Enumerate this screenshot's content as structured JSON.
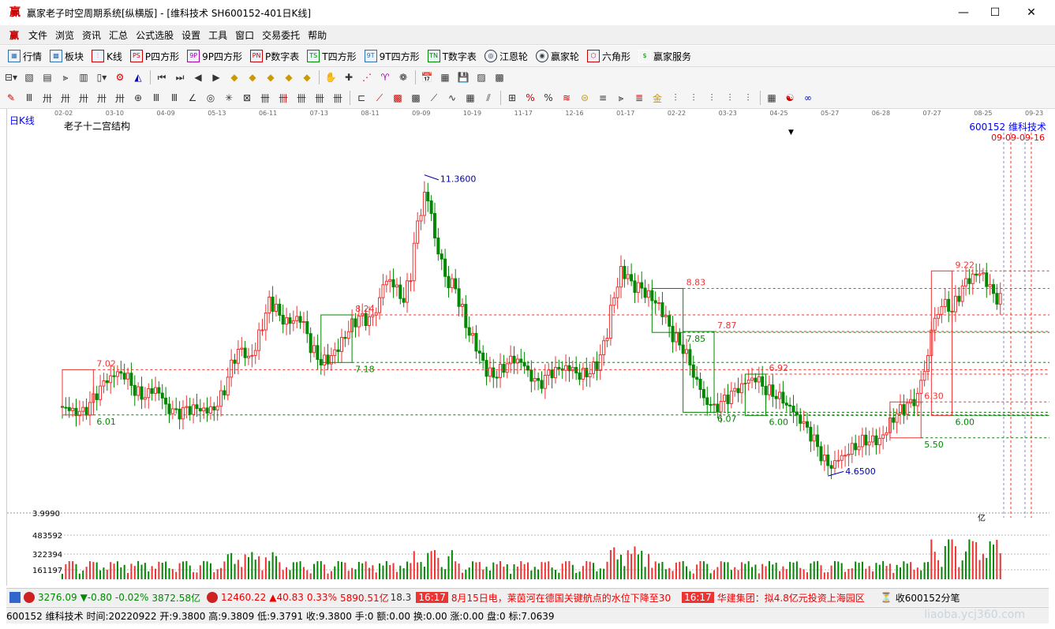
{
  "window": {
    "title": "赢家老子时空周期系统[纵横版] - [维科技术  SH600152-401日K线]",
    "min": "—",
    "max": "☐",
    "close": "✕"
  },
  "menu": [
    "文件",
    "浏览",
    "资讯",
    "汇总",
    "公式选股",
    "设置",
    "工具",
    "窗口",
    "交易委托",
    "帮助"
  ],
  "toolbar1": [
    {
      "label": "行情",
      "icon": "grid-icon"
    },
    {
      "label": "板块",
      "icon": "blocks-icon"
    },
    {
      "label": "K线",
      "icon": "candle-icon"
    },
    {
      "label": "P四方形",
      "icon": "ps-icon"
    },
    {
      "label": "9P四方形",
      "icon": "9p-icon"
    },
    {
      "label": "P数字表",
      "icon": "pn-icon"
    },
    {
      "label": "T四方形",
      "icon": "ts-icon"
    },
    {
      "label": "9T四方形",
      "icon": "9t-icon"
    },
    {
      "label": "T数字表",
      "icon": "tn-icon"
    },
    {
      "label": "江恩轮",
      "icon": "gann-wheel-icon"
    },
    {
      "label": "赢家轮",
      "icon": "winner-wheel-icon"
    },
    {
      "label": "六角形",
      "icon": "hexagon-icon"
    },
    {
      "label": "赢家服务",
      "icon": "dollar-icon"
    }
  ],
  "chart_data": {
    "type": "candlestick",
    "period_label": "日K线",
    "indicator_label": "老子十二宫结构",
    "code_label": "600152  维科技术",
    "red_date_label": "09-09-09-16",
    "date_ticks": [
      "02-02",
      "03-10",
      "04-09",
      "05-13",
      "06-11",
      "07-13",
      "08-11",
      "09-09",
      "10-19",
      "11-17",
      "12-16",
      "01-17",
      "02-22",
      "03-23",
      "04-25",
      "05-27",
      "06-28",
      "07-27",
      "08-25",
      "09-23"
    ],
    "ylim": [
      4.3,
      11.6
    ],
    "high_label": "11.3600",
    "low_label": "4.6500",
    "levels": [
      {
        "value": "7.02",
        "color": "red"
      },
      {
        "value": "6.01",
        "color": "green"
      },
      {
        "value": "8.24",
        "color": "red"
      },
      {
        "value": "7.18",
        "color": "green"
      },
      {
        "value": "8.83",
        "color": "red"
      },
      {
        "value": "7.85",
        "color": "green"
      },
      {
        "value": "7.87",
        "color": "red"
      },
      {
        "value": "6.07",
        "color": "green"
      },
      {
        "value": "6.92",
        "color": "red"
      },
      {
        "value": "6.00",
        "color": "green"
      },
      {
        "value": "6.30",
        "color": "red"
      },
      {
        "value": "5.50",
        "color": "green"
      },
      {
        "value": "9.22",
        "color": "red"
      },
      {
        "value": "6.00",
        "color": "green"
      }
    ],
    "close_path": [
      6.2,
      6.1,
      6.0,
      6.3,
      6.7,
      6.9,
      7.0,
      6.6,
      6.4,
      6.7,
      6.2,
      6.0,
      6.1,
      6.15,
      6.1,
      6.2,
      6.8,
      7.6,
      7.2,
      7.6,
      8.6,
      8.2,
      8.0,
      8.3,
      7.6,
      7.2,
      7.3,
      7.6,
      8.0,
      8.2,
      8.0,
      8.9,
      9.1,
      8.4,
      9.6,
      11.2,
      10.1,
      9.0,
      8.9,
      8.0,
      7.6,
      7.0,
      6.9,
      7.2,
      7.3,
      7.0,
      6.6,
      6.9,
      7.0,
      7.1,
      6.9,
      7.0,
      7.2,
      8.2,
      9.3,
      8.9,
      8.8,
      8.6,
      8.4,
      7.8,
      7.6,
      7.0,
      6.4,
      6.1,
      6.3,
      6.5,
      6.7,
      6.9,
      6.6,
      6.5,
      6.3,
      6.0,
      5.7,
      5.3,
      4.8,
      5.0,
      5.2,
      5.4,
      5.5,
      5.4,
      5.8,
      6.1,
      6.2,
      6.5,
      7.8,
      8.6,
      8.3,
      8.9,
      9.1,
      9.2,
      8.6
    ],
    "volume_axis": [
      "3.9990",
      "483592",
      "322394",
      "161197"
    ],
    "volume_unit": "亿"
  },
  "status": {
    "index1_value": "3276.09",
    "index1_change": "▼-0.80",
    "index1_pct": "-0.02%",
    "index1_amount": "3872.58亿",
    "index2_value": "12460.22",
    "index2_change": "▲40.83",
    "index2_pct": "0.33%",
    "index2_amount": "5890.51亿",
    "ticker_partial": "18.3",
    "news1_time": "16:17",
    "news1_text": "8月15日电，莱茵河在德国关键航点的水位下降至30",
    "news2_time": "16:17",
    "news2_text": "华建集团：拟4.8亿元投资上海园区",
    "right_text": "收600152分笔"
  },
  "quote": {
    "text": "600152 维科技术 时间:20220922 开:9.3800 高:9.3809 低:9.3791 收:9.3800 手:0 额:0.00 换:0.00 涨:0.00 盘:0 标:7.0639"
  },
  "watermark": "liaoba.ycj360.com"
}
